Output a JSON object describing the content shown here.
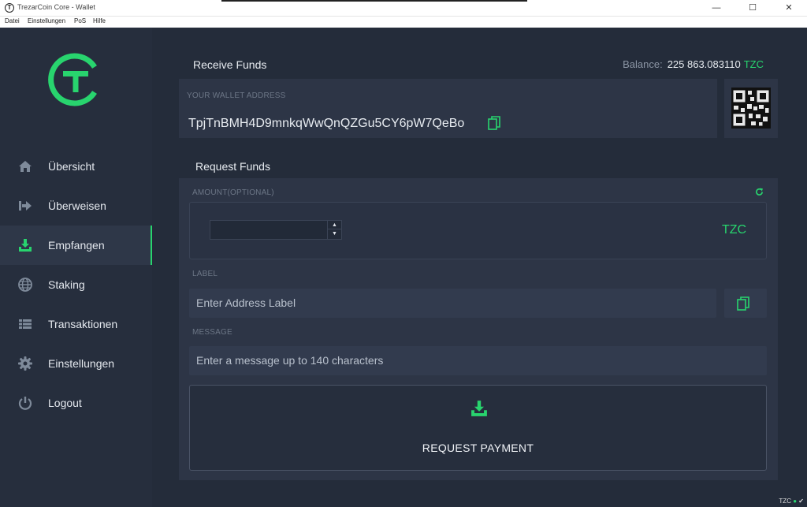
{
  "window": {
    "title": "TrezarCoin Core - Wallet",
    "minimize": "—",
    "maximize": "☐",
    "close": "✕"
  },
  "menu": [
    "Datei",
    "Einstellungen",
    "PoS",
    "Hilfe"
  ],
  "sidebar": {
    "items": [
      {
        "label": "Übersicht",
        "icon": "home-icon"
      },
      {
        "label": "Überweisen",
        "icon": "send-icon"
      },
      {
        "label": "Empfangen",
        "icon": "receive-icon",
        "active": true
      },
      {
        "label": "Staking",
        "icon": "globe-icon"
      },
      {
        "label": "Transaktionen",
        "icon": "list-icon"
      },
      {
        "label": "Einstellungen",
        "icon": "gear-icon"
      },
      {
        "label": "Logout",
        "icon": "power-icon"
      }
    ]
  },
  "receive": {
    "title": "Receive Funds",
    "wallet_address_label": "YOUR WALLET ADDRESS",
    "wallet_address": "TpjTnBMH4D9mnkqWwQnQZGu5CY6pW7QeBo"
  },
  "balance": {
    "label": "Balance:",
    "value": "225 863.083110",
    "unit": "TZC"
  },
  "request": {
    "title": "Request Funds",
    "amount_label": "AMOUNT(OPTIONAL)",
    "amount_value": "",
    "amount_unit": "TZC",
    "label_label": "LABEL",
    "label_placeholder": "Enter Address Label",
    "message_label": "MESSAGE",
    "message_placeholder": "Enter a message up to 140 characters",
    "button_label": "REQUEST PAYMENT"
  },
  "status_bar": {
    "unit": "TZC"
  },
  "colors": {
    "accent": "#28d46e",
    "background": "#242c3a",
    "panel": "#2d3546",
    "sidebar": "#262e3d"
  }
}
